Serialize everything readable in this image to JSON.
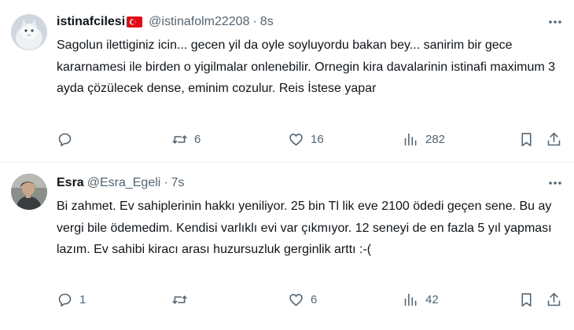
{
  "tweets": [
    {
      "display_name": "istinafcilesi",
      "handle": "@istinafolm22208",
      "separator": "·",
      "time": "8s",
      "text": "Sagolun ilettiginiz icin... gecen yil da oyle soyluyordu bakan bey... sanirim bir gece kararnamesi ile birden o yigilmalar onlenebilir. Ornegin kira davalarinin istinafi maximum 3 ayda çözülecek dense, eminim cozulur. Reis İstese yapar",
      "reply_count": "",
      "retweet_count": "6",
      "like_count": "16",
      "view_count": "282"
    },
    {
      "display_name": "Esra",
      "handle": "@Esra_Egeli",
      "separator": "·",
      "time": "7s",
      "text": "Bi zahmet. Ev sahiplerinin hakkı yeniliyor. 25 bin Tl lik eve 2100 ödedi geçen sene. Bu ay vergi bile ödemedim. Kendisi varlıklı evi var çıkmıyor. 12 seneyi de en fazla 5 yıl yapması lazım. Ev sahibi kiracı arası  huzursuzluk  gerginlik arttı :-(",
      "reply_count": "1",
      "retweet_count": "",
      "like_count": "6",
      "view_count": "42"
    }
  ],
  "colors": {
    "text": "#0f1419",
    "secondary": "#536471",
    "divider": "#eff3f4",
    "flag_red": "#e30a17"
  },
  "icons": [
    "reply-icon",
    "retweet-icon",
    "like-icon",
    "views-icon",
    "bookmark-icon",
    "share-icon",
    "more-icon",
    "turkey-flag-icon"
  ]
}
